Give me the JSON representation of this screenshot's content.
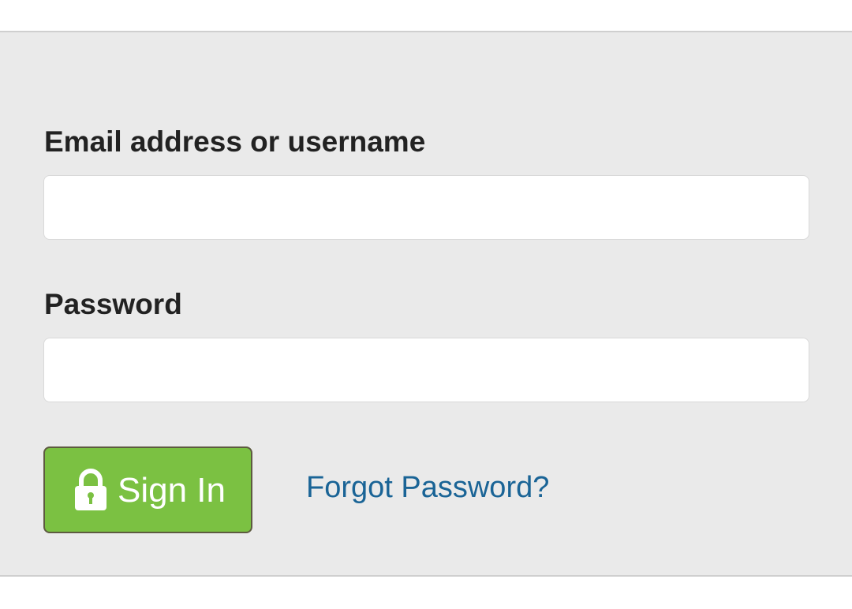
{
  "form": {
    "email": {
      "label": "Email address or username",
      "value": "",
      "placeholder": ""
    },
    "password": {
      "label": "Password",
      "value": "",
      "placeholder": ""
    },
    "signin_button": {
      "icon": "lock-icon",
      "label": "Sign In"
    },
    "forgot_password_link": "Forgot Password?"
  },
  "colors": {
    "panel_background": "#eaeaea",
    "button_background": "#7bc142",
    "link": "#1a6496"
  }
}
